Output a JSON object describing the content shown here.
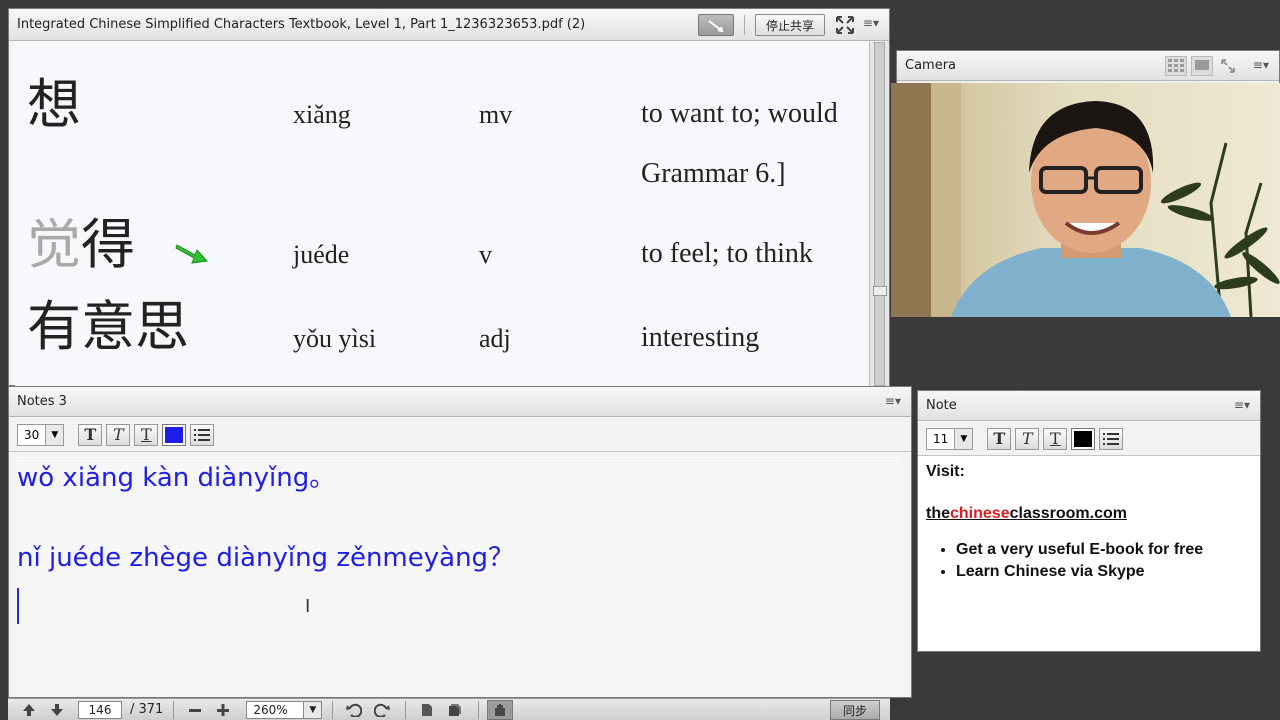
{
  "pdf_pod": {
    "title": "Integrated Chinese Simplified Characters Textbook, Level 1, Part 1_1236323653.pdf (2)",
    "stop_share_label": "停止共享",
    "menu": "≡▾",
    "rows": [
      {
        "hanzi": "想",
        "hanzi_faded": "",
        "pinyin": "xiǎng",
        "pos": "mv",
        "meaning": "to want to; would"
      },
      {
        "hanzi": "",
        "hanzi_faded": "",
        "pinyin": "",
        "pos": "",
        "meaning": "Grammar 6.]"
      },
      {
        "hanzi": "得",
        "hanzi_faded": "觉",
        "pinyin": "juéde",
        "pos": "v",
        "meaning": "to feel; to think"
      },
      {
        "hanzi": "有意思",
        "hanzi_faded": "",
        "pinyin": "yǒu yìsi",
        "pos": "adj",
        "meaning": "interesting"
      }
    ]
  },
  "camera_pod": {
    "title": "Camera",
    "menu": "≡▾"
  },
  "notes_pod": {
    "title": "Notes 3",
    "menu": "≡▾",
    "font_size": "30",
    "text_color": "#1e1ee6",
    "lines": [
      "wǒ xiǎng kàn diànyǐng。",
      "",
      "nǐ juéde zhège diànyǐng zěnmeyàng？"
    ]
  },
  "note_pod": {
    "title": "Note",
    "menu": "≡▾",
    "font_size": "11",
    "text_color": "#000000",
    "visit": "Visit:",
    "link_pre": "the",
    "link_red": "chinese",
    "link_post": "classroom.com",
    "bullets": [
      "Get a very useful E-book for free",
      "Learn Chinese via Skype"
    ]
  },
  "pdf_nav": {
    "current_page": "146",
    "total_pages": "/ 371",
    "zoom": "260%",
    "sync_label": "同步"
  },
  "icons": [
    "draw-icon",
    "fullscreen-icon",
    "menu-icon",
    "arrow-icon",
    "bold-icon",
    "italic-icon",
    "plain-text-icon",
    "list-icon",
    "up-arrow-icon",
    "down-arrow-icon",
    "minus-icon",
    "plus-icon",
    "undo-icon",
    "redo-icon",
    "page-icon",
    "pages-icon",
    "hand-icon",
    "grid-view-icon",
    "single-view-icon",
    "expand-icon"
  ]
}
